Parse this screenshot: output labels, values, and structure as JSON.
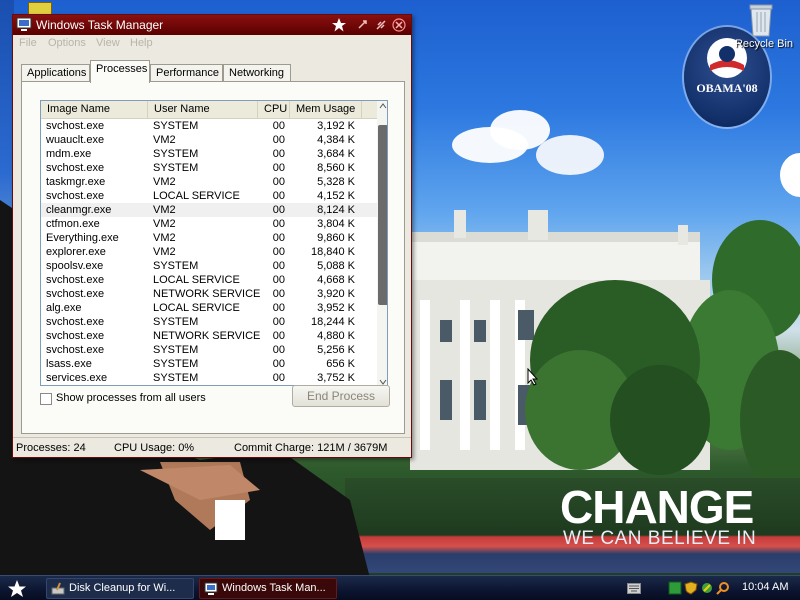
{
  "desktop": {
    "recycle_bin_label": "Recycle Bin",
    "badge_text": "OBAMA'08",
    "wallpaper_title": "CHANGE",
    "wallpaper_subtitle": "WE CAN BELIEVE IN"
  },
  "window": {
    "title": "Windows Task Manager",
    "menu": [
      "File",
      "Options",
      "View",
      "Help"
    ],
    "tabs": [
      {
        "label": "Applications",
        "active": false
      },
      {
        "label": "Processes",
        "active": true
      },
      {
        "label": "Performance",
        "active": false
      },
      {
        "label": "Networking",
        "active": false
      }
    ],
    "columns": {
      "name": "Image Name",
      "user": "User Name",
      "cpu": "CPU",
      "mem": "Mem Usage"
    },
    "processes": [
      {
        "name": "svchost.exe",
        "user": "SYSTEM",
        "cpu": "00",
        "mem": "3,192 K"
      },
      {
        "name": "wuauclt.exe",
        "user": "VM2",
        "cpu": "00",
        "mem": "4,384 K"
      },
      {
        "name": "mdm.exe",
        "user": "SYSTEM",
        "cpu": "00",
        "mem": "3,684 K"
      },
      {
        "name": "svchost.exe",
        "user": "SYSTEM",
        "cpu": "00",
        "mem": "8,560 K"
      },
      {
        "name": "taskmgr.exe",
        "user": "VM2",
        "cpu": "00",
        "mem": "5,328 K"
      },
      {
        "name": "svchost.exe",
        "user": "LOCAL SERVICE",
        "cpu": "00",
        "mem": "4,152 K"
      },
      {
        "name": "cleanmgr.exe",
        "user": "VM2",
        "cpu": "00",
        "mem": "8,124 K"
      },
      {
        "name": "ctfmon.exe",
        "user": "VM2",
        "cpu": "00",
        "mem": "3,804 K"
      },
      {
        "name": "Everything.exe",
        "user": "VM2",
        "cpu": "00",
        "mem": "9,860 K"
      },
      {
        "name": "explorer.exe",
        "user": "VM2",
        "cpu": "00",
        "mem": "18,840 K"
      },
      {
        "name": "spoolsv.exe",
        "user": "SYSTEM",
        "cpu": "00",
        "mem": "5,088 K"
      },
      {
        "name": "svchost.exe",
        "user": "LOCAL SERVICE",
        "cpu": "00",
        "mem": "4,668 K"
      },
      {
        "name": "svchost.exe",
        "user": "NETWORK SERVICE",
        "cpu": "00",
        "mem": "3,920 K"
      },
      {
        "name": "alg.exe",
        "user": "LOCAL SERVICE",
        "cpu": "00",
        "mem": "3,952 K"
      },
      {
        "name": "svchost.exe",
        "user": "SYSTEM",
        "cpu": "00",
        "mem": "18,244 K"
      },
      {
        "name": "svchost.exe",
        "user": "NETWORK SERVICE",
        "cpu": "00",
        "mem": "4,880 K"
      },
      {
        "name": "svchost.exe",
        "user": "SYSTEM",
        "cpu": "00",
        "mem": "5,256 K"
      },
      {
        "name": "lsass.exe",
        "user": "SYSTEM",
        "cpu": "00",
        "mem": "656 K"
      },
      {
        "name": "services.exe",
        "user": "SYSTEM",
        "cpu": "00",
        "mem": "3,752 K"
      }
    ],
    "selected_row": 6,
    "show_all_label": "Show processes from all users",
    "show_all_checked": false,
    "end_process_label": "End Process",
    "status": {
      "processes": "Processes: 24",
      "cpu": "CPU Usage: 0%",
      "commit": "Commit Charge: 121M / 3679M"
    }
  },
  "taskbar": {
    "items": [
      {
        "label": "Disk Cleanup for Wi...",
        "active": false
      },
      {
        "label": "Windows Task Man...",
        "active": true
      }
    ],
    "clock": "10:04 AM"
  },
  "colors": {
    "titlebar": "#6a0000",
    "taskbar": "#0c1530",
    "accent": "#b81818"
  }
}
